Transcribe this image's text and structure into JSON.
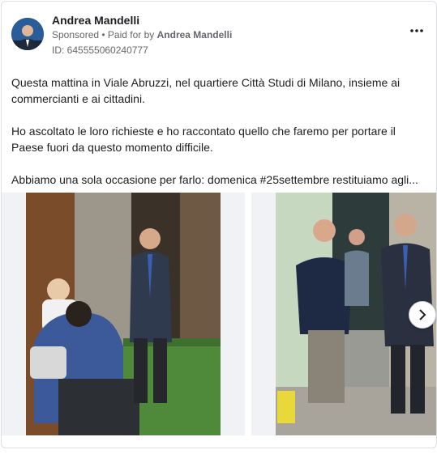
{
  "post": {
    "author": "Andrea Mandelli",
    "sponsored": "Sponsored",
    "paid_for_prefix": " • Paid for by ",
    "paid_for_by": "Andrea Mandelli",
    "ad_id": "ID: 645555060240777",
    "more_icon": "more-horizontal-icon",
    "paragraphs": [
      "Questa mattina in Viale Abruzzi, nel quartiere Città Studi di Milano, insieme ai commercianti e ai cittadini.",
      "Ho ascoltato le loro richieste e ho raccontato quello che faremo per portare il Paese fuori da questo momento difficile.",
      "Abbiamo una sola occasione per farlo: domenica #25settembre restituiamo agli..."
    ]
  },
  "carousel": {
    "next_icon": "chevron-right-icon"
  }
}
